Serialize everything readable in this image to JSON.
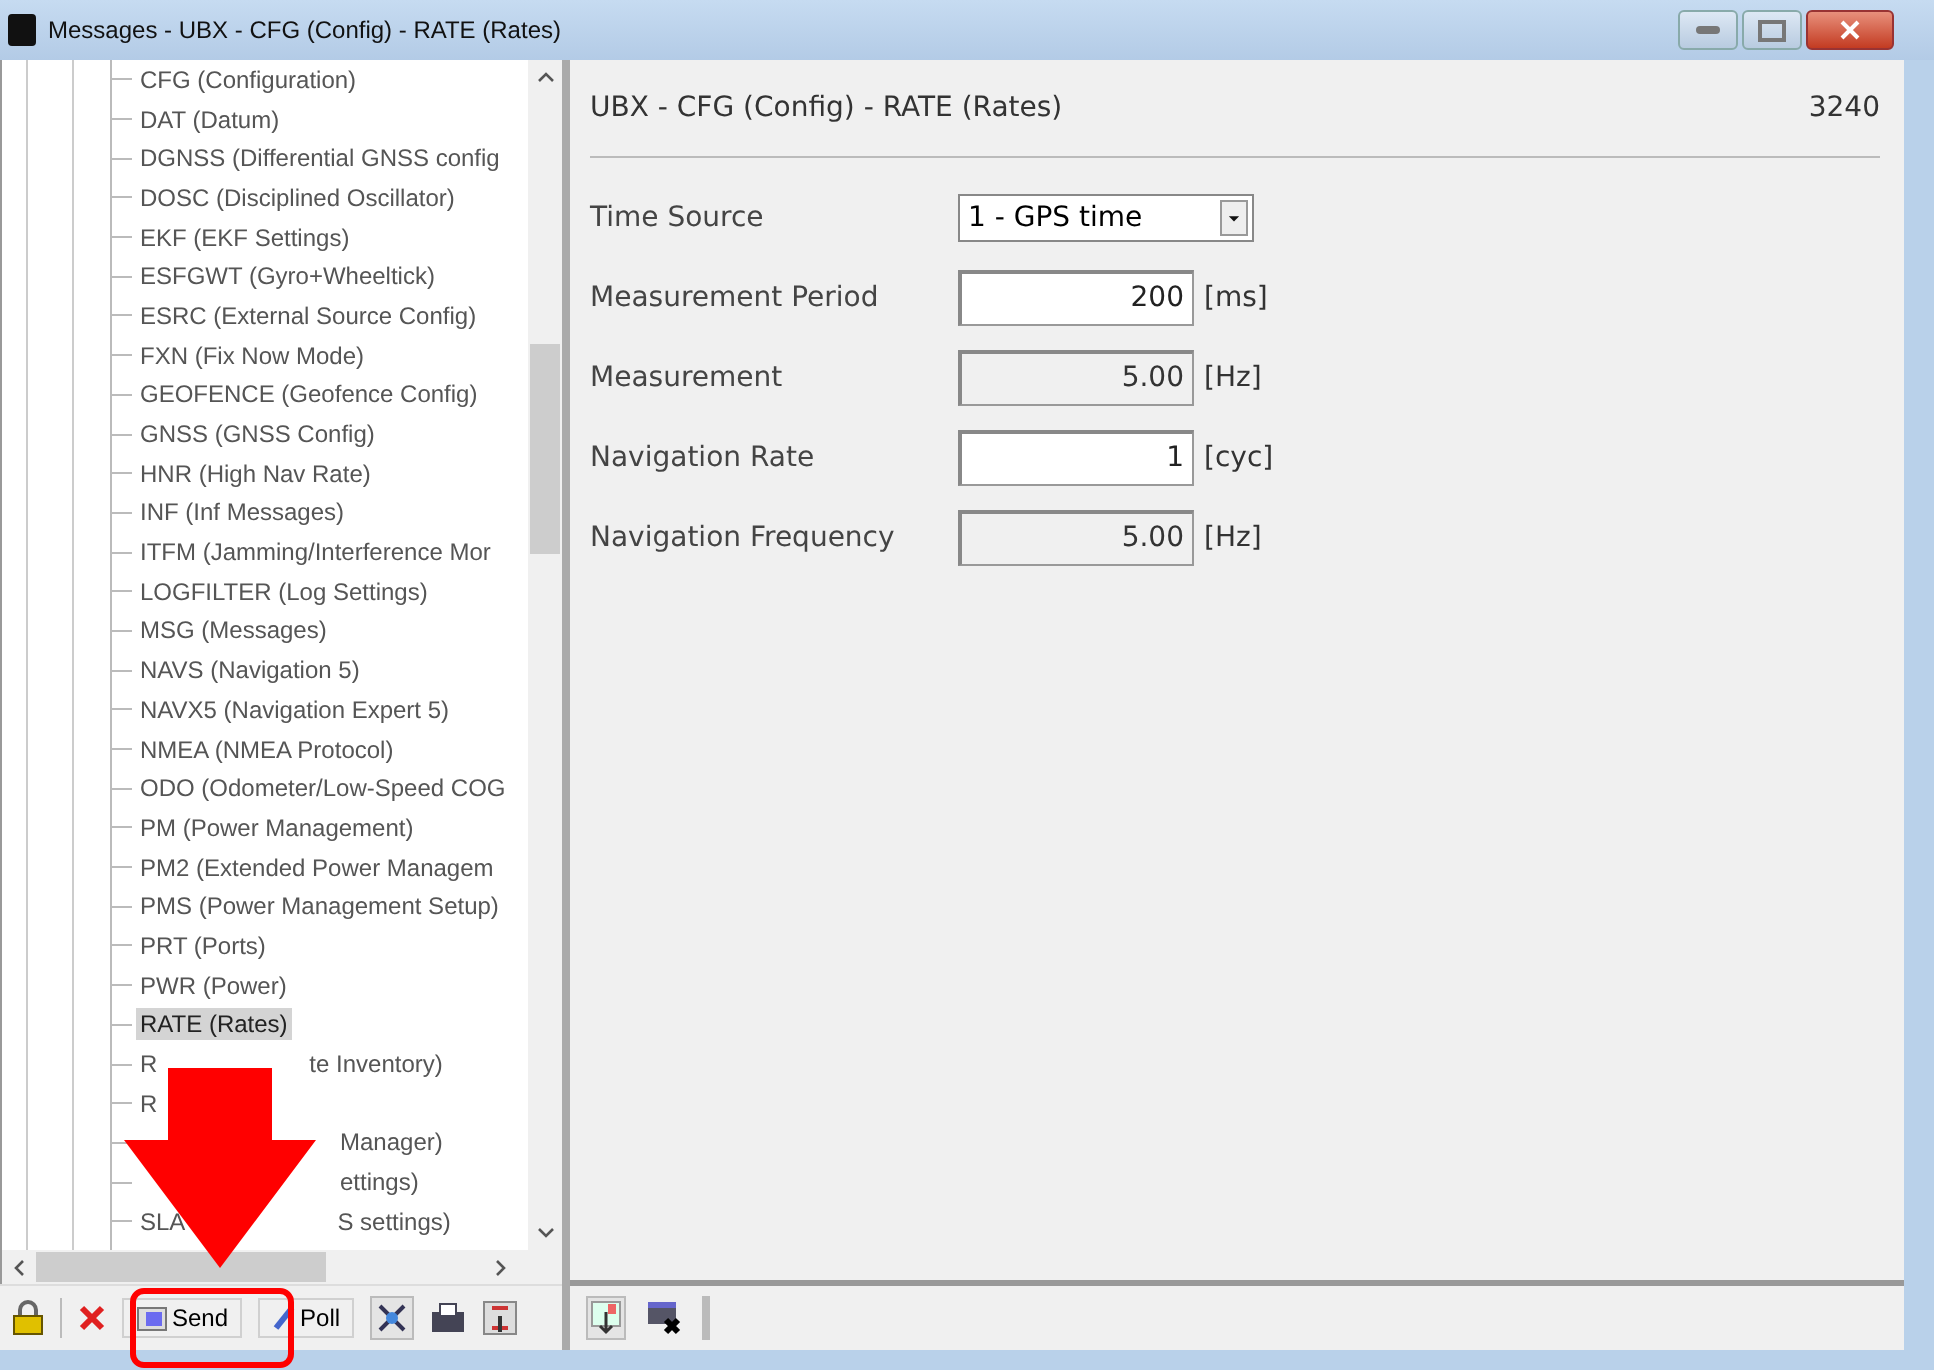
{
  "window": {
    "title": "Messages - UBX - CFG (Config) - RATE (Rates)"
  },
  "tree": {
    "items": [
      {
        "label": "CFG (Configuration)",
        "selected": false
      },
      {
        "label": "DAT (Datum)",
        "selected": false
      },
      {
        "label": "DGNSS (Differential GNSS config",
        "selected": false
      },
      {
        "label": "DOSC (Disciplined Oscillator)",
        "selected": false
      },
      {
        "label": "EKF (EKF Settings)",
        "selected": false
      },
      {
        "label": "ESFGWT (Gyro+Wheeltick)",
        "selected": false
      },
      {
        "label": "ESRC (External Source Config)",
        "selected": false
      },
      {
        "label": "FXN (Fix Now Mode)",
        "selected": false
      },
      {
        "label": "GEOFENCE (Geofence Config)",
        "selected": false
      },
      {
        "label": "GNSS (GNSS Config)",
        "selected": false
      },
      {
        "label": "HNR (High Nav Rate)",
        "selected": false
      },
      {
        "label": "INF (Inf Messages)",
        "selected": false
      },
      {
        "label": "ITFM (Jamming/Interference Mor",
        "selected": false
      },
      {
        "label": "LOGFILTER (Log Settings)",
        "selected": false
      },
      {
        "label": "MSG (Messages)",
        "selected": false
      },
      {
        "label": "NAVS (Navigation 5)",
        "selected": false
      },
      {
        "label": "NAVX5 (Navigation Expert 5)",
        "selected": false
      },
      {
        "label": "NMEA (NMEA Protocol)",
        "selected": false
      },
      {
        "label": "ODO (Odometer/Low-Speed COG",
        "selected": false
      },
      {
        "label": "PM (Power Management)",
        "selected": false
      },
      {
        "label": "PM2 (Extended Power Managem",
        "selected": false
      },
      {
        "label": "PMS (Power Management Setup)",
        "selected": false
      },
      {
        "label": "PRT (Ports)",
        "selected": false
      },
      {
        "label": "PWR (Power)",
        "selected": false
      },
      {
        "label": "RATE (Rates)",
        "selected": true
      },
      {
        "label": "R",
        "after": "te Inventory)",
        "selected": false
      },
      {
        "label": "R",
        "selected": false
      },
      {
        "after": "Manager)",
        "selected": false
      },
      {
        "after": "ettings)",
        "selected": false
      },
      {
        "label": "SLA",
        "after": "S settings)",
        "selected": false
      }
    ]
  },
  "toolbar": {
    "send": "Send",
    "poll": "Poll"
  },
  "panel": {
    "title": "UBX - CFG (Config) - RATE (Rates)",
    "code": "3240",
    "fields": [
      {
        "kind": "select",
        "label": "Time Source",
        "value": "1 - GPS time"
      },
      {
        "kind": "input",
        "label": "Measurement Period",
        "value": "200",
        "unit": "[ms]"
      },
      {
        "kind": "readonly",
        "label": "Measurement",
        "value": "5.00",
        "unit": "[Hz]"
      },
      {
        "kind": "input",
        "label": "Navigation Rate",
        "value": "1",
        "unit": "[cyc]"
      },
      {
        "kind": "readonly",
        "label": "Navigation Frequency",
        "value": "5.00",
        "unit": "[Hz]"
      }
    ]
  }
}
